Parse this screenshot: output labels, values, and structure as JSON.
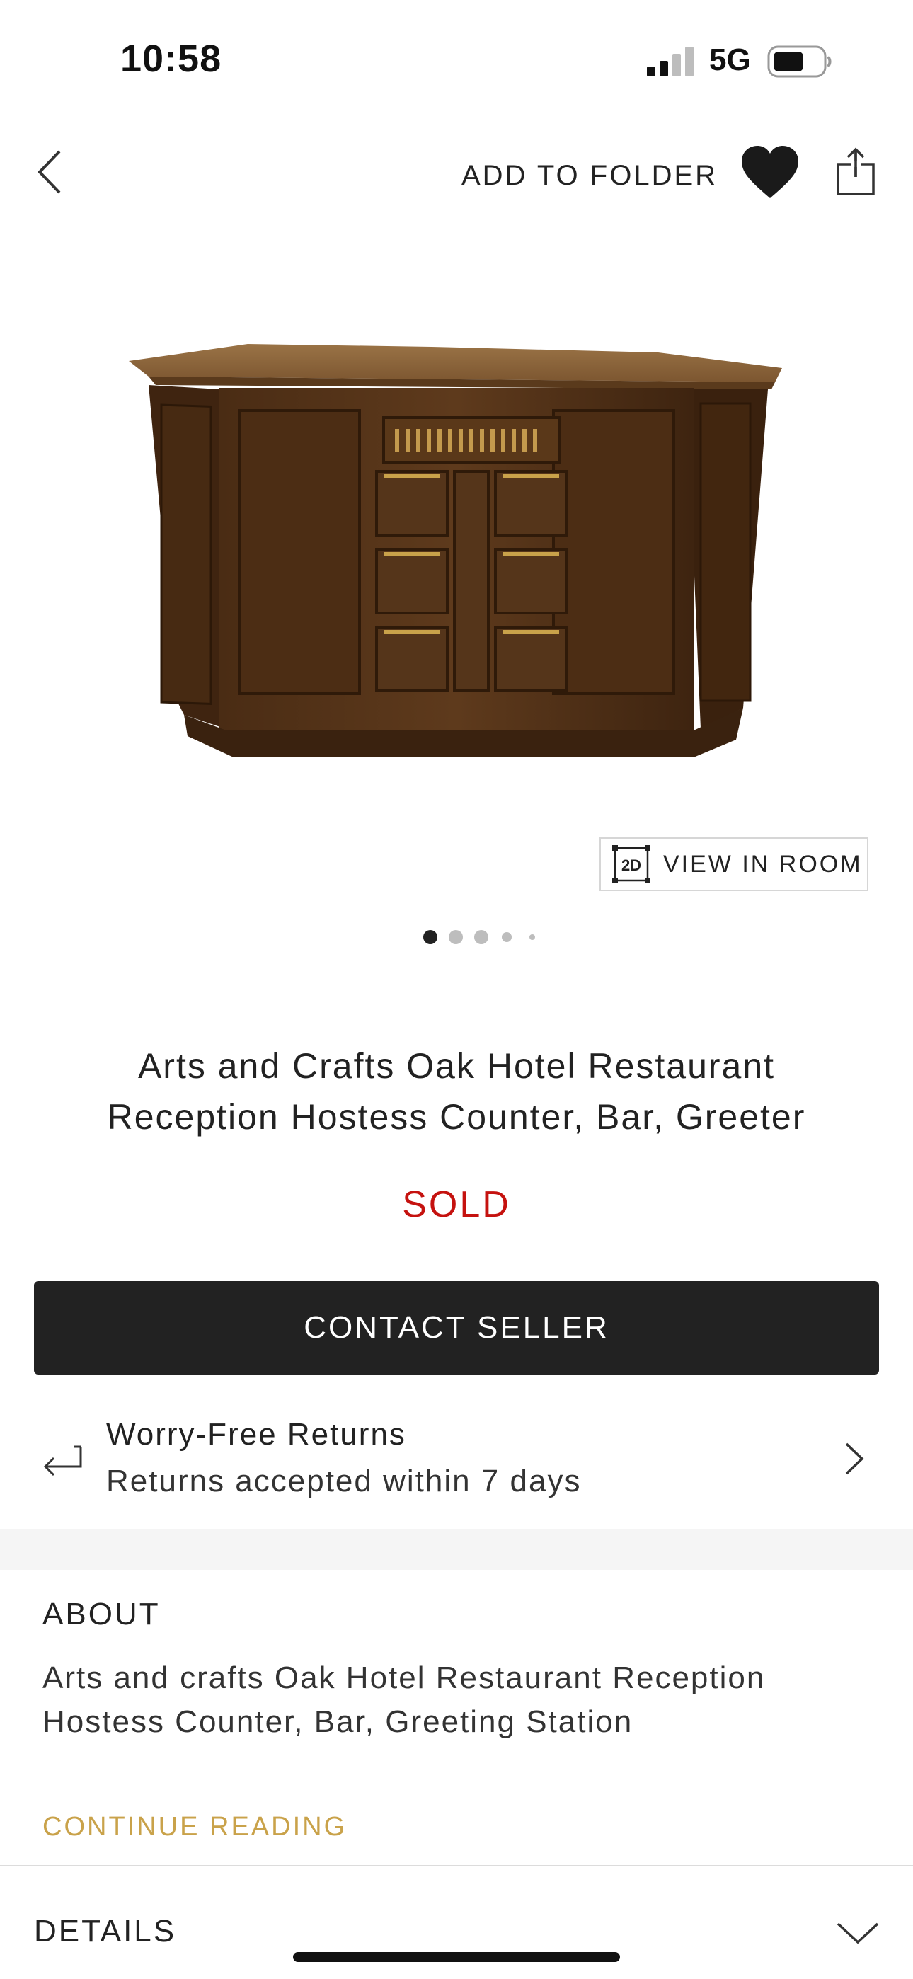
{
  "status_bar": {
    "time": "10:58",
    "network": "5G"
  },
  "nav": {
    "add_to_folder": "ADD TO FOLDER",
    "back_icon": "chevron-left-icon",
    "favorite_icon": "heart-icon",
    "share_icon": "share-icon"
  },
  "gallery": {
    "view_in_room_badge": "2D",
    "view_in_room_label": "VIEW IN ROOM",
    "image_count": 5,
    "active_index": 1
  },
  "product": {
    "title_line1": "Arts and Crafts Oak Hotel Restaurant",
    "title_line2": "Reception Hostess Counter, Bar, Greeter",
    "status": "SOLD",
    "status_color": "#c5120f"
  },
  "actions": {
    "contact_seller": "CONTACT SELLER"
  },
  "returns": {
    "title": "Worry-Free Returns",
    "subtitle": "Returns accepted within 7 days"
  },
  "about": {
    "heading": "ABOUT",
    "text": "Arts and crafts Oak Hotel Restaurant Reception Hostess Counter, Bar, Greeting Station",
    "continue_reading": "CONTINUE READING",
    "accent_color": "#c9a24a"
  },
  "details": {
    "heading": "DETAILS"
  }
}
